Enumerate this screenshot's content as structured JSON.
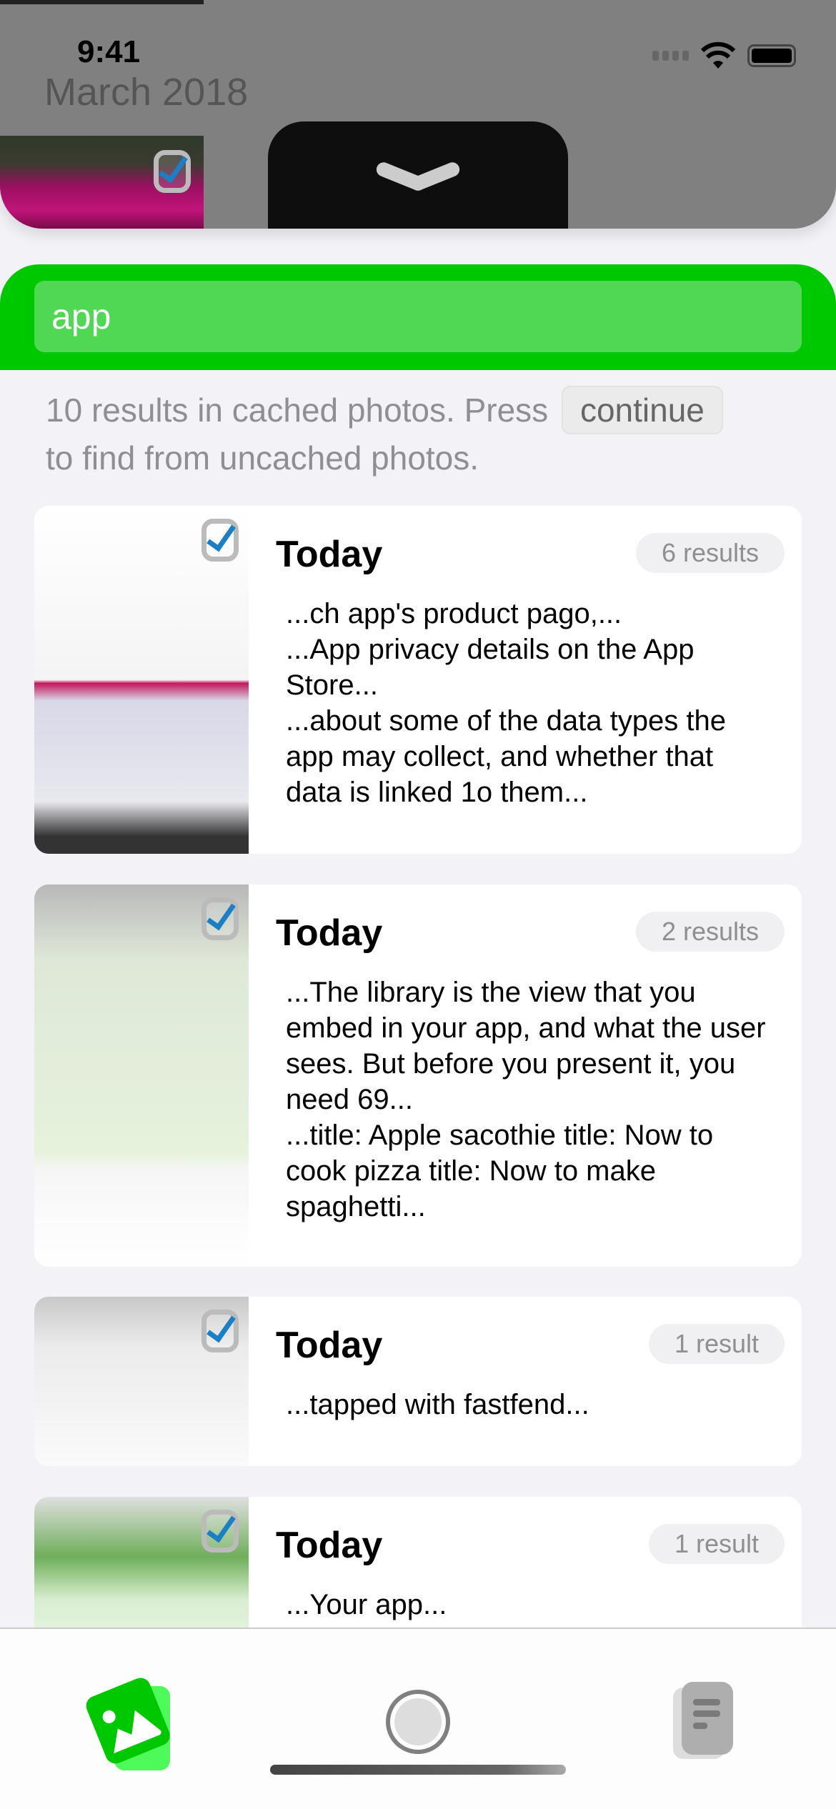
{
  "status_bar": {
    "time": "9:41"
  },
  "header": {
    "month": "March 2018"
  },
  "search": {
    "value": "app"
  },
  "info": {
    "text_before": "10 results in cached photos. Press",
    "continue_label": "continue",
    "text_after": "to find from uncached photos."
  },
  "results": [
    {
      "title": "Today",
      "badge": "6 results",
      "snippets": [
        "...ch app's product pago,...",
        "...App privacy details on the App Store...",
        "...about some of the data types the app may collect, and whether that data is linked 1o them..."
      ]
    },
    {
      "title": "Today",
      "badge": "2 results",
      "snippets": [
        "...The library is the view that you embed in your app, and what the user sees. But before you present it, you need 69...",
        "...title: Apple sacothie title: Now to cook pizza title: Now to make spaghetti..."
      ]
    },
    {
      "title": "Today",
      "badge": "1 result",
      "snippets": [
        "...tapped with fastfend..."
      ]
    },
    {
      "title": "Today",
      "badge": "1 result",
      "snippets": [
        "...Your app..."
      ]
    }
  ],
  "tab_bar": {
    "items": [
      {
        "icon": "photos-icon",
        "active": true
      },
      {
        "icon": "capture-icon"
      },
      {
        "icon": "documents-icon"
      }
    ]
  },
  "colors": {
    "accent": "#00c800",
    "search_field": "#50d855"
  }
}
